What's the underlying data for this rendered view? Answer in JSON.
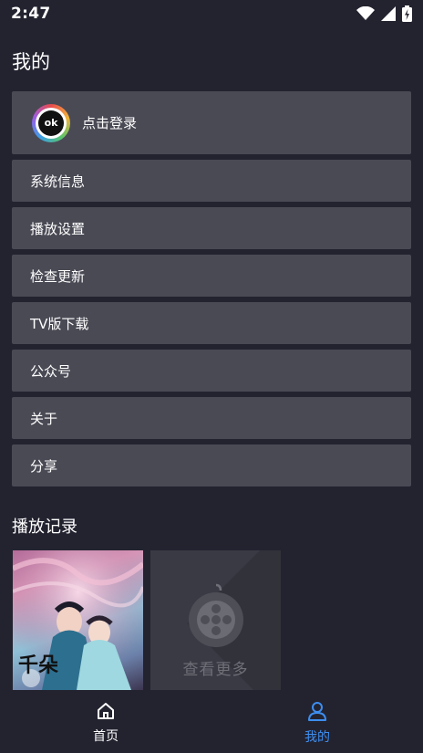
{
  "status_bar": {
    "time": "2:47",
    "icons": [
      "wifi-icon",
      "signal-icon",
      "battery-charging-icon"
    ]
  },
  "page": {
    "title": "我的"
  },
  "login": {
    "logo_text": "ok",
    "label": "点击登录"
  },
  "menu": {
    "items": [
      {
        "label": "系统信息"
      },
      {
        "label": "播放设置"
      },
      {
        "label": "检查更新"
      },
      {
        "label": "TV版下载"
      },
      {
        "label": "公众号"
      },
      {
        "label": "关于"
      },
      {
        "label": "分享"
      }
    ]
  },
  "history": {
    "title": "播放记录",
    "poster_title": "千朵",
    "more_label": "查看更多"
  },
  "bottom_nav": {
    "items": [
      {
        "label": "首页",
        "icon": "home-icon"
      },
      {
        "label": "我的",
        "icon": "user-icon"
      }
    ],
    "active_index": 1
  },
  "colors": {
    "background": "#232330",
    "card": "#4a4a55",
    "accent": "#3d8ef0"
  }
}
